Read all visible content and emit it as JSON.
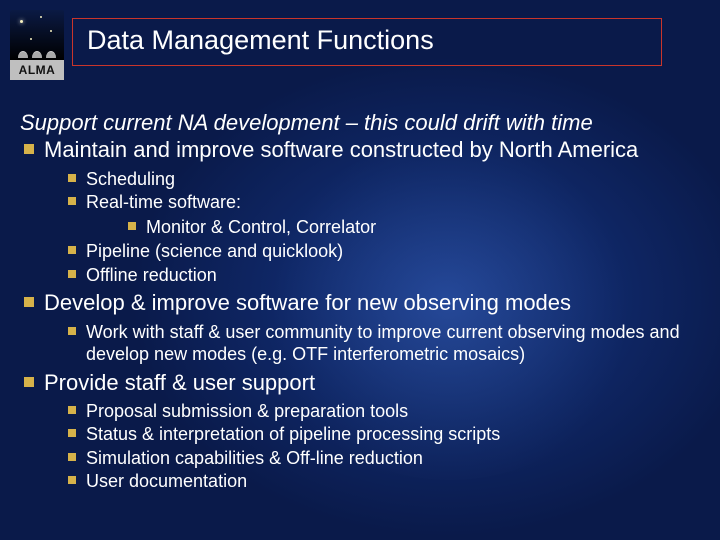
{
  "logo": {
    "label": "ALMA"
  },
  "title": "Data Management Functions",
  "subtitle": "Support current NA development – this could drift with time",
  "bullets": {
    "b1": {
      "text": "Maintain and improve software constructed by North America",
      "sub": {
        "s1": "Scheduling",
        "s2": "Real-time software:",
        "s2_sub": {
          "a": "Monitor & Control, Correlator"
        },
        "s3": "Pipeline (science and quicklook)",
        "s4": "Offline reduction"
      }
    },
    "b2": {
      "text": "Develop & improve software for new observing modes",
      "sub": {
        "s1": "Work with staff & user community to improve current observing modes and develop new modes (e.g. OTF interferometric mosaics)"
      }
    },
    "b3": {
      "text": "Provide staff & user support",
      "sub": {
        "s1": "Proposal submission & preparation tools",
        "s2": "Status & interpretation of pipeline processing scripts",
        "s3": "Simulation capabilities & Off-line reduction",
        "s4": "User documentation"
      }
    }
  }
}
